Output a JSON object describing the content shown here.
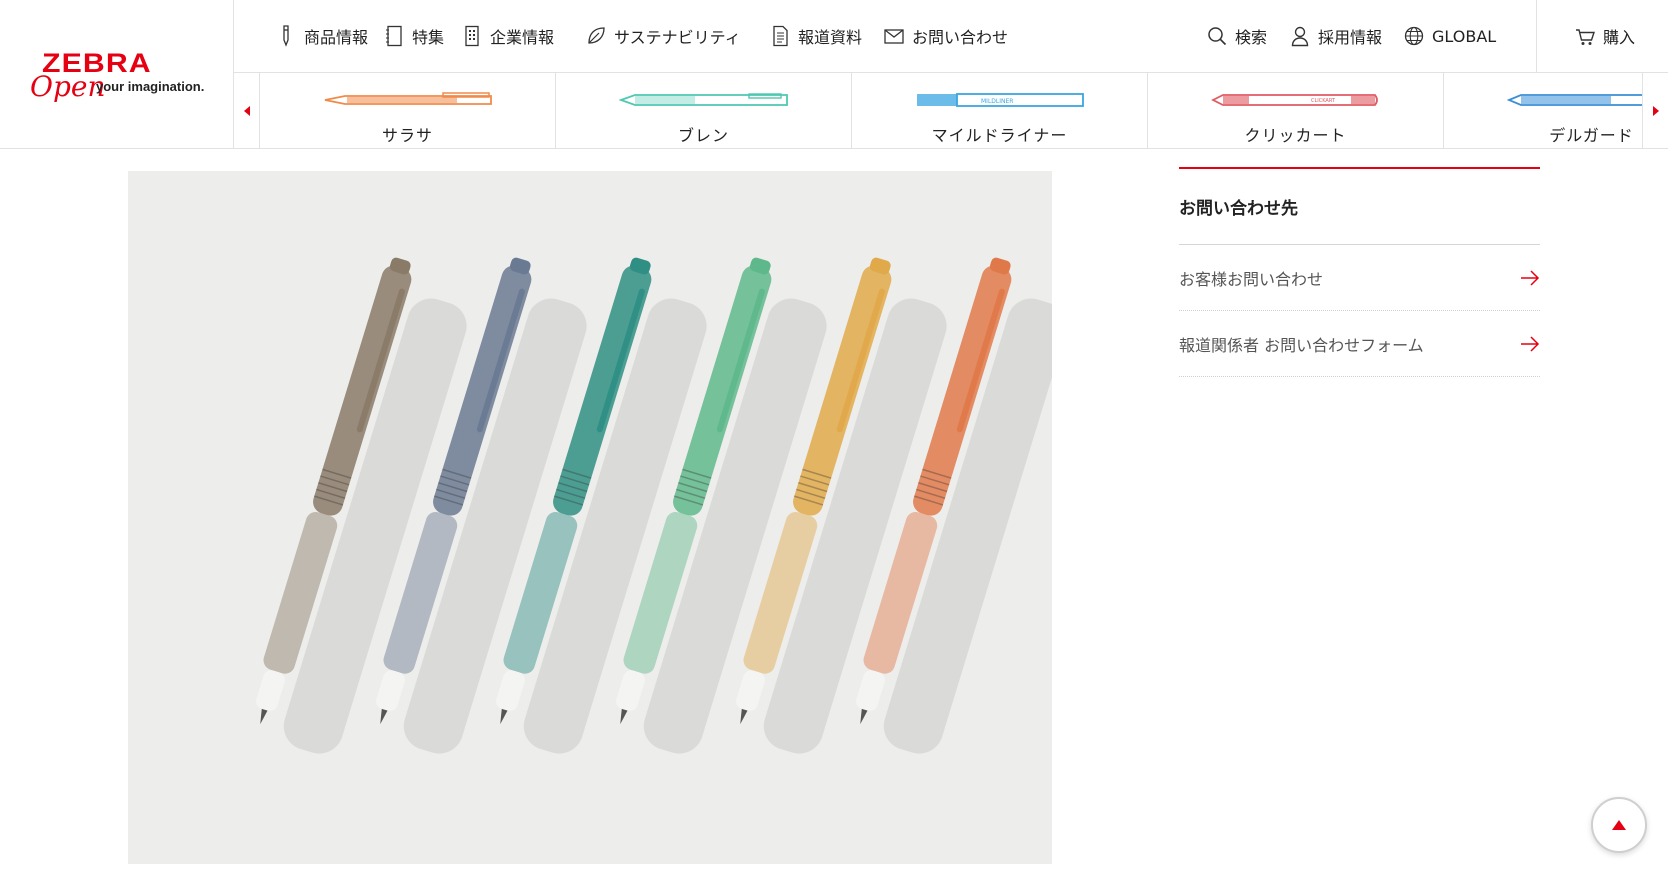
{
  "brand": {
    "name": "ZEBRA",
    "script": "Open",
    "tagline": "your imagination.",
    "color": "#e50012"
  },
  "nav": {
    "items": [
      {
        "label": "商品情報",
        "icon": "pen-icon"
      },
      {
        "label": "特集",
        "icon": "notebook-icon"
      },
      {
        "label": "企業情報",
        "icon": "building-icon"
      },
      {
        "label": "サステナビリティ",
        "icon": "leaf-icon"
      },
      {
        "label": "報道資料",
        "icon": "document-icon"
      },
      {
        "label": "お問い合わせ",
        "icon": "mail-icon"
      }
    ],
    "utility": [
      {
        "label": "検索",
        "icon": "search-icon"
      },
      {
        "label": "採用情報",
        "icon": "person-icon"
      },
      {
        "label": "GLOBAL",
        "icon": "globe-icon"
      }
    ],
    "buy": {
      "label": "購入",
      "icon": "cart-icon"
    }
  },
  "carousel": {
    "items": [
      {
        "label": "サラサ",
        "color": "#f08a4b"
      },
      {
        "label": "ブレン",
        "color": "#4fc8b2"
      },
      {
        "label": "マイルドライナー",
        "color": "#3aa6e0"
      },
      {
        "label": "クリッカート",
        "color": "#e05a62"
      },
      {
        "label": "デルガード",
        "color": "#3a8fd8"
      }
    ]
  },
  "hero": {
    "pen_colors": [
      "#8a7a68",
      "#6b7a93",
      "#2f8f84",
      "#5fb88c",
      "#e0a94a",
      "#e0794a"
    ]
  },
  "sidebar": {
    "heading": "お問い合わせ先",
    "links": [
      {
        "label": "お客様お問い合わせ"
      },
      {
        "label": "報道関係者 お問い合わせフォーム"
      }
    ]
  }
}
